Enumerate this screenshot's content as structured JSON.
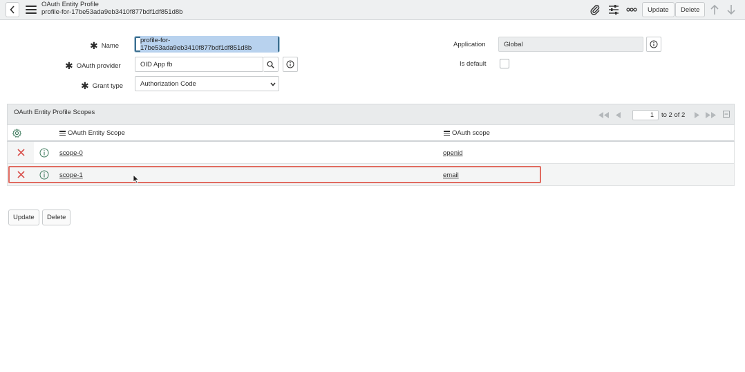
{
  "header": {
    "title": "OAuth Entity Profile",
    "subtitle": "profile-for-17be53ada9eb3410f877bdf1df851d8b",
    "update_label": "Update",
    "delete_label": "Delete"
  },
  "form": {
    "name_label": "Name",
    "name_value": "profile-for-17be53ada9eb3410f877bdf1df851d8b",
    "provider_label": "OAuth provider",
    "provider_value": "OID App fb",
    "grant_label": "Grant type",
    "grant_value": "Authorization Code",
    "application_label": "Application",
    "application_value": "Global",
    "is_default_label": "Is default"
  },
  "related_list": {
    "title": "OAuth Entity Profile Scopes",
    "page_value": "1",
    "page_text": "to 2 of 2",
    "columns": [
      "OAuth Entity Scope",
      "OAuth scope"
    ],
    "rows": [
      {
        "entity_scope": "scope-0",
        "oauth_scope": "openid"
      },
      {
        "entity_scope": "scope-1",
        "oauth_scope": "email"
      }
    ]
  },
  "footer": {
    "update_label": "Update",
    "delete_label": "Delete"
  },
  "colors": {
    "delete_x": "#d9534f",
    "highlight": "#e06b60",
    "info_green": "#3c7a5c"
  }
}
